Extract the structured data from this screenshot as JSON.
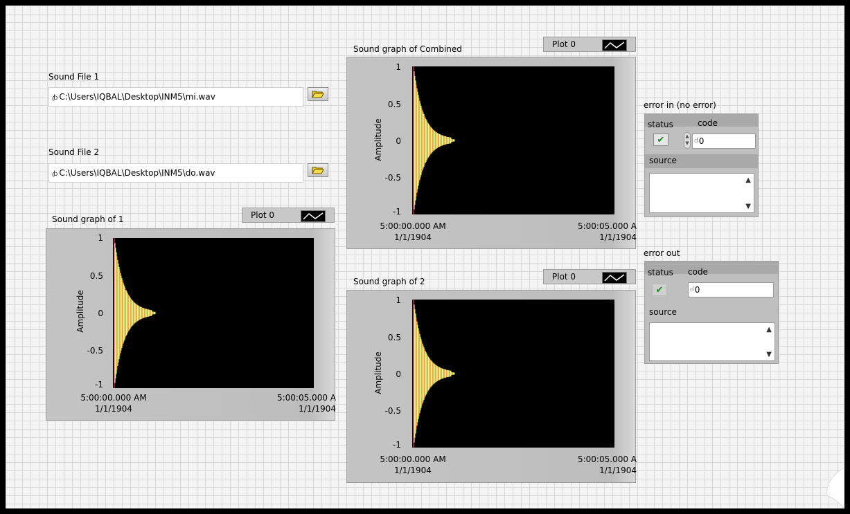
{
  "file1": {
    "label": "Sound File 1",
    "path": "C:\\Users\\IQBAL\\Desktop\\INM5\\mi.wav",
    "path_icon": "ꞗ"
  },
  "file2": {
    "label": "Sound File 2",
    "path": "C:\\Users\\IQBAL\\Desktop\\INM5\\do.wav",
    "path_icon": "ꞗ"
  },
  "graph1": {
    "title": "Sound graph of 1",
    "legend": "Plot 0",
    "ylabel": "Amplitude",
    "yticks": [
      "1",
      "0.5",
      "0",
      "-0.5",
      "-1"
    ],
    "xstart": [
      "5:00:00.000 AM",
      "1/1/1904"
    ],
    "xend": [
      "5:00:05.000 A",
      "1/1/1904"
    ]
  },
  "graph_combined": {
    "title": "Sound graph of Combined",
    "legend": "Plot 0",
    "ylabel": "Amplitude",
    "yticks": [
      "1",
      "0.5",
      "0",
      "-0.5",
      "-1"
    ],
    "xstart": [
      "5:00:00.000 AM",
      "1/1/1904"
    ],
    "xend": [
      "5:00:05.000 A",
      "1/1/1904"
    ]
  },
  "graph2": {
    "title": "Sound graph of 2",
    "legend": "Plot 0",
    "ylabel": "Amplitude",
    "yticks": [
      "1",
      "0.5",
      "0",
      "-0.5",
      "-1"
    ],
    "xstart": [
      "5:00:00.000 AM",
      "1/1/1904"
    ],
    "xend": [
      "5:00:05.000 A",
      "1/1/1904"
    ]
  },
  "error_in": {
    "title": "error in (no error)",
    "status_label": "status",
    "code_label": "code",
    "code_value": "0",
    "source_label": "source",
    "check": "✔"
  },
  "error_out": {
    "title": "error out",
    "status_label": "status",
    "code_label": "code",
    "code_value": "0",
    "source_label": "source",
    "check": "✔"
  },
  "icons": {
    "folder": "folder-open-icon",
    "check": "checkmark-icon",
    "scroll_up": "▲",
    "scroll_down": "▼"
  },
  "colors": {
    "waveform": [
      "#ff3b3b",
      "#ffffff",
      "#8cff3a",
      "#ffff3a"
    ],
    "plot_bg": "#000000",
    "frame": "#c0c0c0"
  }
}
